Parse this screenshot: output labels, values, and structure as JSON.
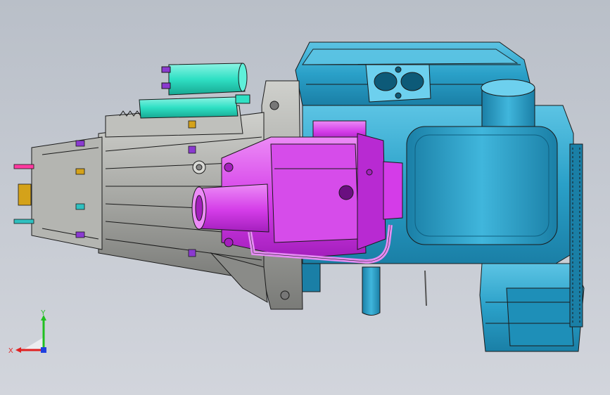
{
  "viewport": {
    "background_top": "#b9bfc8",
    "background_bottom": "#d2d5dc"
  },
  "colors": {
    "block_blue": "#2aa0c8",
    "block_blue_dark": "#1a7fa6",
    "block_blue_light": "#5cc4e4",
    "housing_magenta": "#d43ce8",
    "housing_magenta_dark": "#a41fbd",
    "housing_magenta_light": "#ec8bf6",
    "gearbox_gray": "#a7a8a4",
    "gearbox_gray_dark": "#6d6e6b",
    "gearbox_gray_light": "#c9cac6",
    "cyan_part": "#2fe0c4",
    "pin_pink": "#ff3aa0",
    "pin_purple": "#8a3ad0",
    "nut_gold": "#d4a21a",
    "edge_line": "#1a1a1a"
  },
  "triad": {
    "x_label": "X",
    "y_label": "Y",
    "x_color": "#e02020",
    "y_color": "#20c020",
    "z_color": "#2040e0",
    "icon": "coordinate-triad-icon"
  }
}
